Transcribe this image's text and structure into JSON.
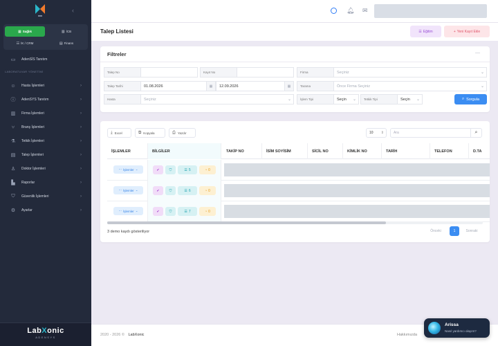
{
  "sidebar": {
    "modules": [
      {
        "label": "Sağlık",
        "icon": "grid-icon",
        "active": true
      },
      {
        "label": "İCB",
        "icon": "building-icon",
        "active": false
      },
      {
        "label": "İK / CRM",
        "icon": "users-icon",
        "active": false
      },
      {
        "label": "Finans",
        "icon": "document-icon",
        "active": false
      }
    ],
    "intro": "AdenSİS Tanıtım",
    "section_label": "LABORATUVAR YÖNETİMİ",
    "items": [
      {
        "label": "Hasta İşlemleri",
        "icon": "users-icon"
      },
      {
        "label": "AdenSYS Tanıtım",
        "icon": "info-icon"
      },
      {
        "label": "Firma İşlemleri",
        "icon": "building-icon"
      },
      {
        "label": "Branş İşlemleri",
        "icon": "branch-icon"
      },
      {
        "label": "Tetkik İşlemleri",
        "icon": "flask-icon"
      },
      {
        "label": "Talep İşlemleri",
        "icon": "clipboard-icon"
      },
      {
        "label": "Doktor İşlemleri",
        "icon": "doctor-icon"
      },
      {
        "label": "Raporlar",
        "icon": "chart-icon"
      },
      {
        "label": "Güvenlik İşlemleri",
        "icon": "shield-icon"
      },
      {
        "label": "Ayarlar",
        "icon": "gear-icon"
      }
    ],
    "brand_name_a": "Lab",
    "brand_name_x": "X",
    "brand_name_b": "onic",
    "brand_sub": "ADENSYS"
  },
  "page": {
    "title": "Talep Listesi",
    "egitim_label": "Eğitim",
    "yeni_label": "Yeni Kayıt Ekle"
  },
  "filters": {
    "title": "Filtreler",
    "talep_no_label": "Talep No",
    "kayit_no_label": "Kayıt No",
    "firma_label": "Firma",
    "firma_placeholder": "Seçiniz",
    "talep_tarihi_label": "Talep Tarihi",
    "date_from": "01.08.2026",
    "date_to": "12.09.2026",
    "tarama_label": "Tarama",
    "tarama_placeholder": "Önce Firma Seçiniz",
    "hasta_label": "Hasta",
    "hasta_placeholder": "Seçiniz",
    "islem_tipi_label": "İşlem Tipi",
    "islem_tipi_value": "Seçin",
    "tetkik_tipi_label": "Tetkik Tipi",
    "tetkik_tipi_value": "Seçin",
    "sorgula_label": "Sorgula"
  },
  "table": {
    "excel_label": "Excel",
    "kopyala_label": "Kopyala",
    "yazdir_label": "Yazdır",
    "page_size": "10",
    "search_placeholder": "Ara",
    "columns": [
      "İŞLEMLER",
      "BİLGİLER",
      "TAKİP NO",
      "İSİM SOYİSİM",
      "SİCİL NO",
      "KİMLİK NO",
      "TARİH",
      "TELEFON",
      "D.TA"
    ],
    "ops_label": "İşlemler",
    "rows": [
      {
        "count_a": "5",
        "count_b": "0"
      },
      {
        "count_a": "6",
        "count_b": "0"
      },
      {
        "count_a": "7",
        "count_b": "0"
      }
    ],
    "showing": "3 demo kaydı gösteriliyor",
    "prev": "Önceki",
    "page": "1",
    "next": "Sonraki"
  },
  "footer": {
    "copyright": "2020 - 2026 ©",
    "brand": "LabXonic",
    "right": "Hakkımızda"
  },
  "chat": {
    "name": "Arissa",
    "message": "Nasıl yardımcı olayım?"
  },
  "colors": {
    "sidebar_bg": "#232a3b",
    "active_module": "#2aa84c",
    "primary": "#3b8df2",
    "egitim": "#9a4ed6",
    "yeni": "#e0556a"
  }
}
